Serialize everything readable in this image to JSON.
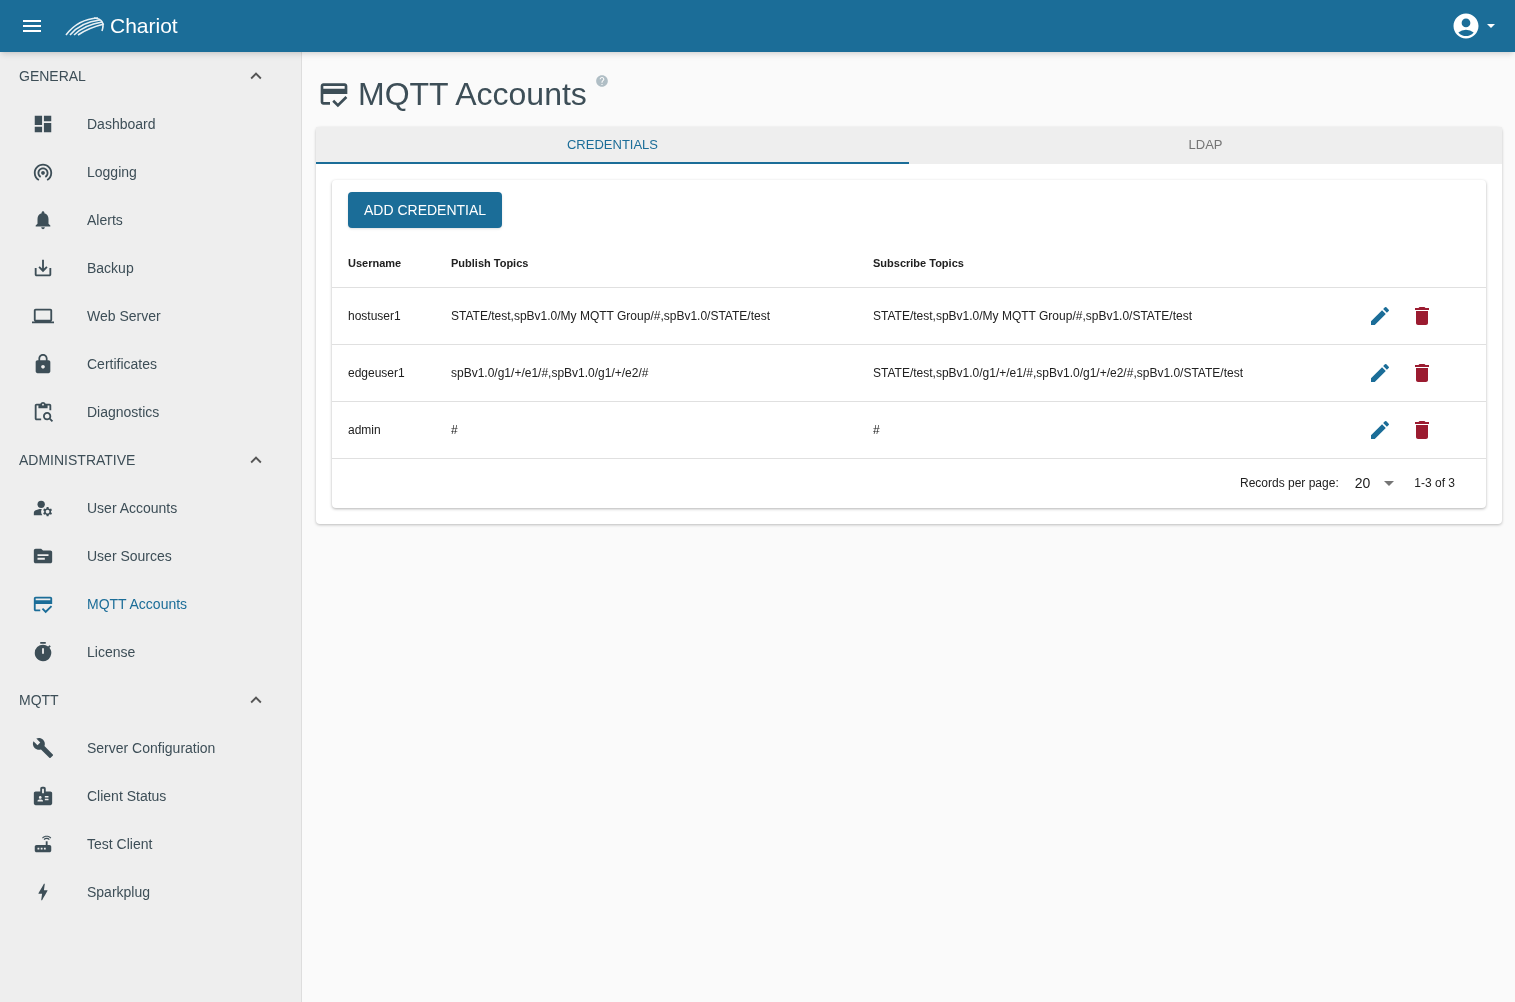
{
  "app": {
    "title": "Chariot"
  },
  "sidebar": {
    "sections": [
      {
        "title": "GENERAL",
        "expanded": true,
        "items": [
          {
            "label": "Dashboard",
            "selected": false
          },
          {
            "label": "Logging",
            "selected": false
          },
          {
            "label": "Alerts",
            "selected": false
          },
          {
            "label": "Backup",
            "selected": false
          },
          {
            "label": "Web Server",
            "selected": false
          },
          {
            "label": "Certificates",
            "selected": false
          },
          {
            "label": "Diagnostics",
            "selected": false
          }
        ]
      },
      {
        "title": "ADMINISTRATIVE",
        "expanded": true,
        "items": [
          {
            "label": "User Accounts",
            "selected": false
          },
          {
            "label": "User Sources",
            "selected": false
          },
          {
            "label": "MQTT Accounts",
            "selected": true
          },
          {
            "label": "License",
            "selected": false
          }
        ]
      },
      {
        "title": "MQTT",
        "expanded": true,
        "items": [
          {
            "label": "Server Configuration",
            "selected": false
          },
          {
            "label": "Client Status",
            "selected": false
          },
          {
            "label": "Test Client",
            "selected": false
          },
          {
            "label": "Sparkplug",
            "selected": false
          }
        ]
      }
    ]
  },
  "page": {
    "title": "MQTT Accounts"
  },
  "tabs": [
    {
      "label": "CREDENTIALS",
      "selected": true
    },
    {
      "label": "LDAP",
      "selected": false
    }
  ],
  "add_button": "ADD CREDENTIAL",
  "table": {
    "columns": [
      "Username",
      "Publish Topics",
      "Subscribe Topics"
    ],
    "rows": [
      {
        "username": "hostuser1",
        "publish": "STATE/test,spBv1.0/My MQTT Group/#,spBv1.0/STATE/test",
        "subscribe": "STATE/test,spBv1.0/My MQTT Group/#,spBv1.0/STATE/test"
      },
      {
        "username": "edgeuser1",
        "publish": "spBv1.0/g1/+/e1/#,spBv1.0/g1/+/e2/#",
        "subscribe": "STATE/test,spBv1.0/g1/+/e1/#,spBv1.0/g1/+/e2/#,spBv1.0/STATE/test"
      },
      {
        "username": "admin",
        "publish": "#",
        "subscribe": "#"
      }
    ]
  },
  "pagination": {
    "label": "Records per page:",
    "per_page": "20",
    "range": "1-3 of 3"
  }
}
